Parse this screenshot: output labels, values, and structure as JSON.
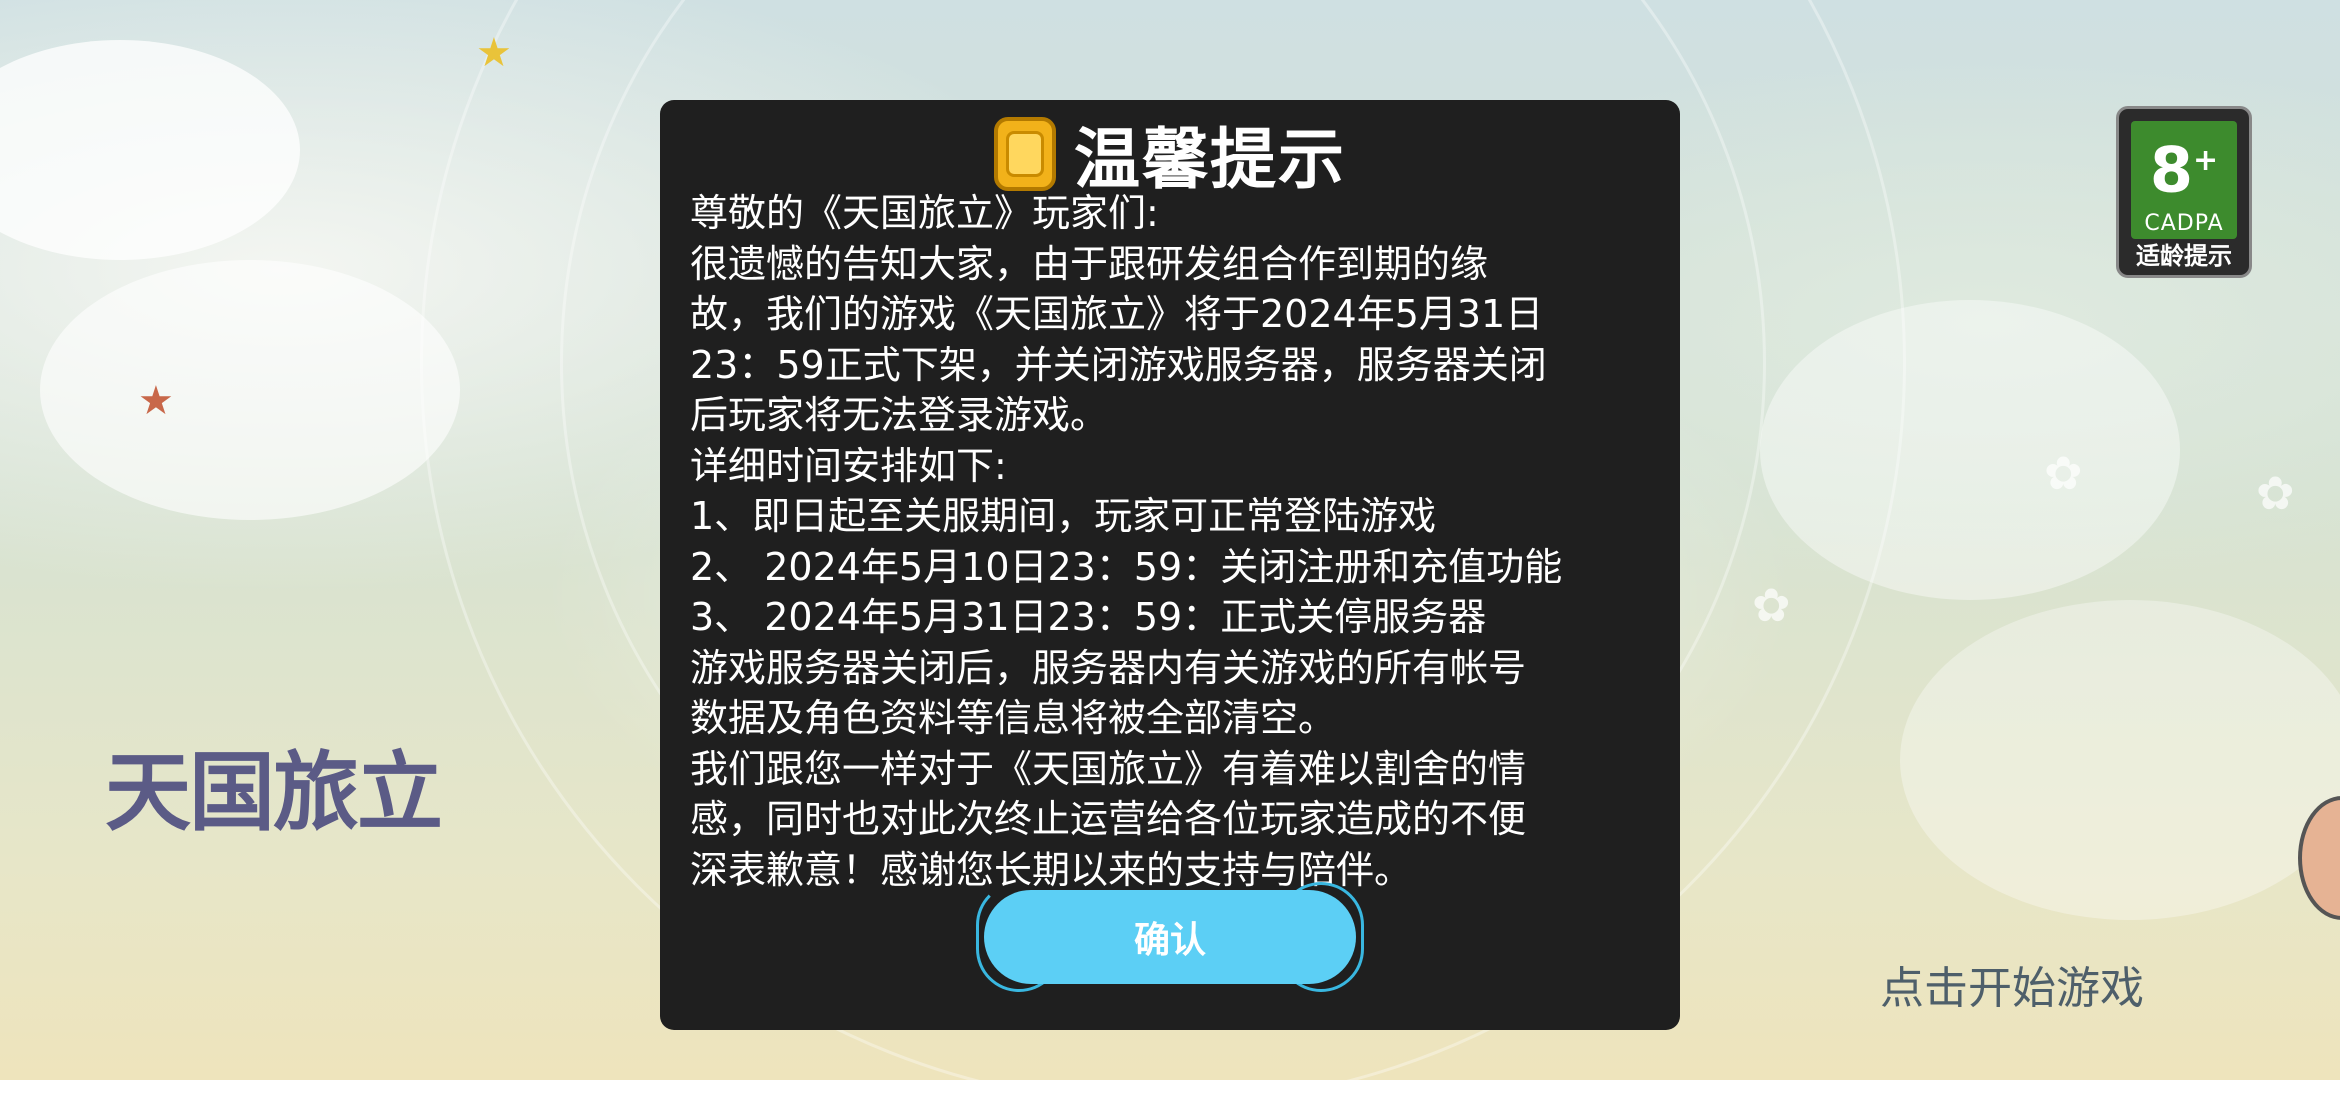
{
  "background": {
    "game_logo": "天国旅立",
    "start_hint": "点击开始游戏",
    "age_badge": {
      "age": "8",
      "plus": "+",
      "org": "CADPA",
      "label": "适龄提示"
    }
  },
  "dialog": {
    "title": "温馨提示",
    "paragraphs": [
      "尊敬的《天国旅立》玩家们:",
      "很遗憾的告知大家，由于跟研发组合作到期的缘",
      "故，我们的游戏《天国旅立》将于2024年5月31日",
      "23：59正式下架，并关闭游戏服务器，服务器关闭",
      "后玩家将无法登录游戏。",
      "详细时间安排如下:",
      "1、即日起至关服期间，玩家可正常登陆游戏",
      "2、 2024年5月10日23：59：关闭注册和充值功能",
      "3、 2024年5月31日23：59：正式关停服务器",
      "游戏服务器关闭后，服务器内有关游戏的所有帐号",
      "数据及角色资料等信息将被全部清空。",
      "我们跟您一样对于《天国旅立》有着难以割舍的情",
      "感，同时也对此次终止运营给各位玩家造成的不便",
      "深表歉意！感谢您长期以来的支持与陪伴。"
    ],
    "confirm_label": "确认"
  },
  "colors": {
    "dialog_bg": "#1f1f1f",
    "confirm_bg": "#5ccff5",
    "age_badge_green": "#3d8b2d"
  }
}
